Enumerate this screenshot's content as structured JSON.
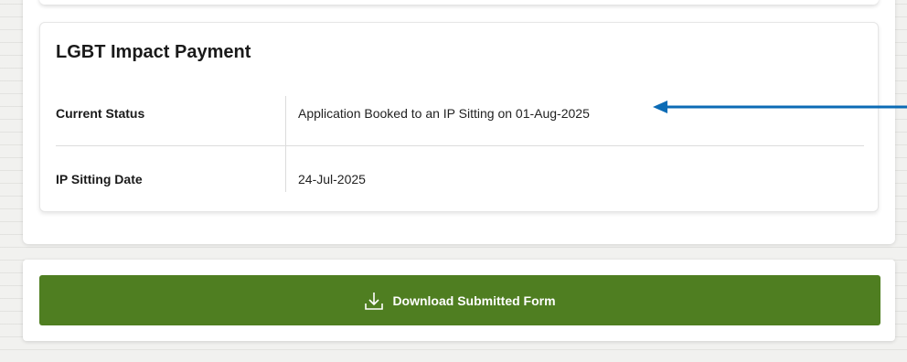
{
  "card": {
    "title": "LGBT Impact Payment",
    "rows": [
      {
        "label": "Current Status",
        "value": "Application Booked to an IP Sitting on 01-Aug-2025"
      },
      {
        "label": "IP Sitting Date",
        "value": "24-Jul-2025"
      }
    ]
  },
  "actions": {
    "download_label": "Download Submitted Form"
  },
  "colors": {
    "button": "#4f7e21",
    "arrow": "#0b6bb5"
  },
  "icons": {
    "download": "download-icon",
    "annotation": "arrow-left-icon"
  }
}
